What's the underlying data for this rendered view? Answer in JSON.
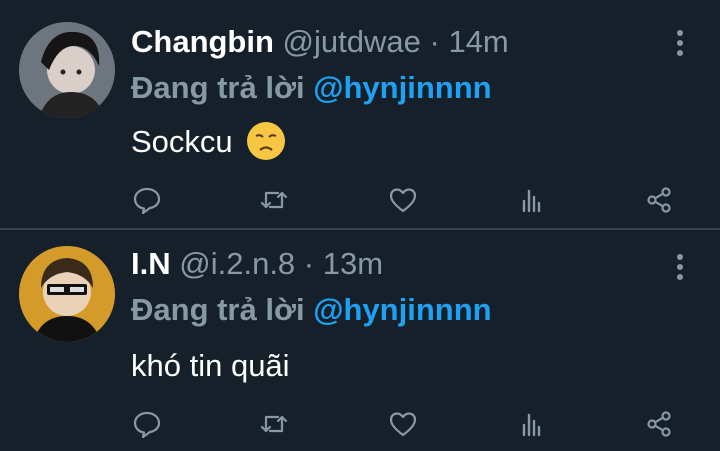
{
  "tweets": [
    {
      "name": "Changbin",
      "handle": "@jutdwae",
      "separator": "·",
      "time": "14m",
      "reply_prefix": "Đang trả lời",
      "reply_to": "@hynjinnnn",
      "text": "Sockcu",
      "emoji": "disappointed-face",
      "avatar_icon": "avatar-changbin"
    },
    {
      "name": "I.N",
      "handle": "@i.2.n.8",
      "separator": "·",
      "time": "13m",
      "reply_prefix": "Đang trả lời",
      "reply_to": "@hynjinnnn",
      "text": "khó tin quãi",
      "avatar_icon": "avatar-in"
    }
  ],
  "actions": [
    "reply-icon",
    "retweet-icon",
    "like-icon",
    "analytics-icon",
    "share-icon"
  ],
  "colors": {
    "background": "#15202b",
    "divider": "#38444d",
    "secondary": "#8899a6",
    "mention": "#1da1f2",
    "emoji": "#f7c744"
  }
}
